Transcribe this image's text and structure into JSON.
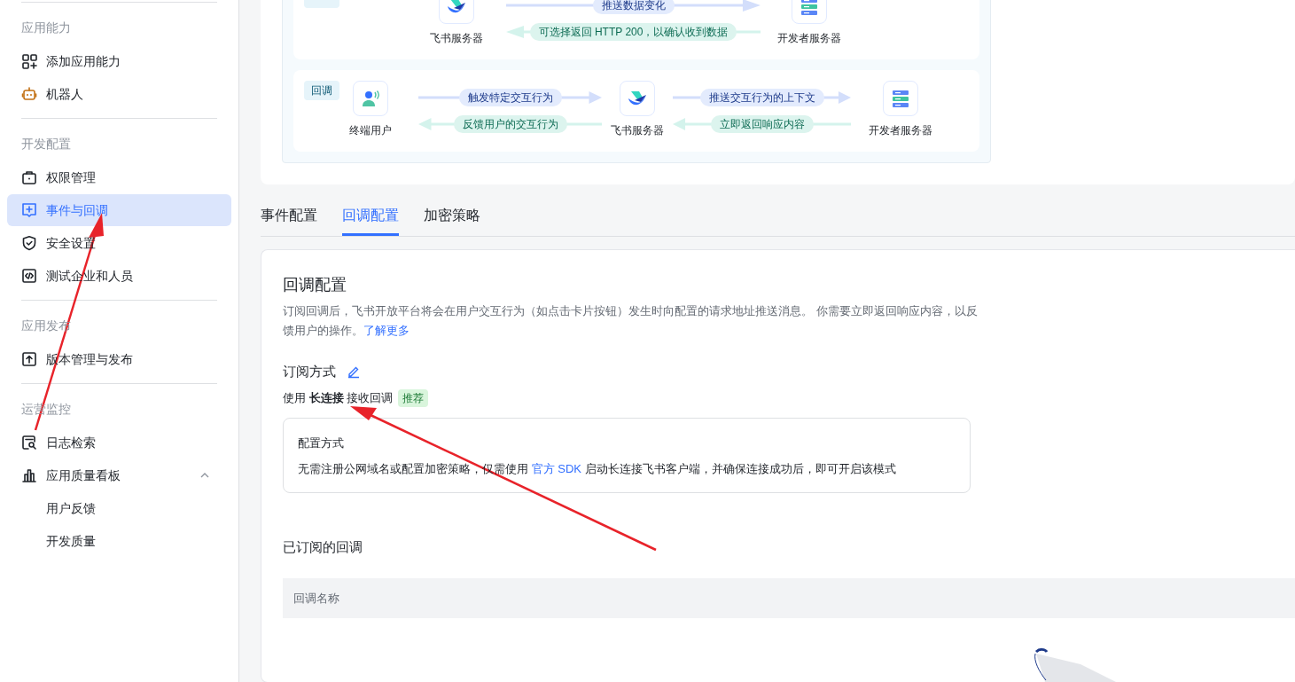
{
  "sidebar": {
    "sections": [
      {
        "header": "应用能力",
        "items": [
          {
            "label": "添加应用能力",
            "selected": false
          },
          {
            "label": "机器人",
            "selected": false
          }
        ]
      },
      {
        "header": "开发配置",
        "items": [
          {
            "label": "权限管理",
            "selected": false
          },
          {
            "label": "事件与回调",
            "selected": true
          },
          {
            "label": "安全设置",
            "selected": false
          },
          {
            "label": "测试企业和人员",
            "selected": false
          }
        ]
      },
      {
        "header": "应用发布",
        "items": [
          {
            "label": "版本管理与发布",
            "selected": false
          }
        ]
      },
      {
        "header": "运营监控",
        "items": [
          {
            "label": "日志检索",
            "selected": false
          },
          {
            "label": "应用质量看板",
            "selected": false,
            "expanded": true,
            "children": [
              {
                "label": "用户反馈",
                "selected": false
              },
              {
                "label": "开发质量",
                "selected": false
              }
            ]
          }
        ]
      }
    ]
  },
  "diagram": {
    "event_row": {
      "nodes": [
        "飞书服务器",
        "开发者服务器"
      ],
      "forward": "推送数据变化",
      "back": "可选择返回 HTTP 200，以确认收到数据"
    },
    "callback_row": {
      "label": "回调",
      "nodes": [
        "终端用户",
        "飞书服务器",
        "开发者服务器"
      ],
      "links": [
        {
          "forward": "触发特定交互行为",
          "back": "反馈用户的交互行为"
        },
        {
          "forward": "推送交互行为的上下文",
          "back": "立即返回响应内容"
        }
      ]
    }
  },
  "tabs": [
    {
      "label": "事件配置",
      "selected": false
    },
    {
      "label": "回调配置",
      "selected": true
    },
    {
      "label": "加密策略",
      "selected": false
    }
  ],
  "panel": {
    "title": "回调配置",
    "description": "订阅回调后，飞书开放平台将会在用户交互行为（如点击卡片按钮）发生时向配置的请求地址推送消息。 你需要立即返回响应内容，以反馈用户的操作。",
    "description_link": "了解更多",
    "subscription_title": "订阅方式",
    "mode": "使用 **长连接** 接收回调",
    "mode_badge": "推荐",
    "config_title": "配置方式",
    "config_text_before": "无需注册公网域名或配置加密策略，仅需使用 ",
    "config_link": "官方 SDK",
    "config_text_after": " 启动长连接飞书客户端，并确保连接成功后，即可开启该模式",
    "subscribed_title": "已订阅的回调",
    "table": {
      "columns": [
        "回调名称"
      ]
    }
  }
}
